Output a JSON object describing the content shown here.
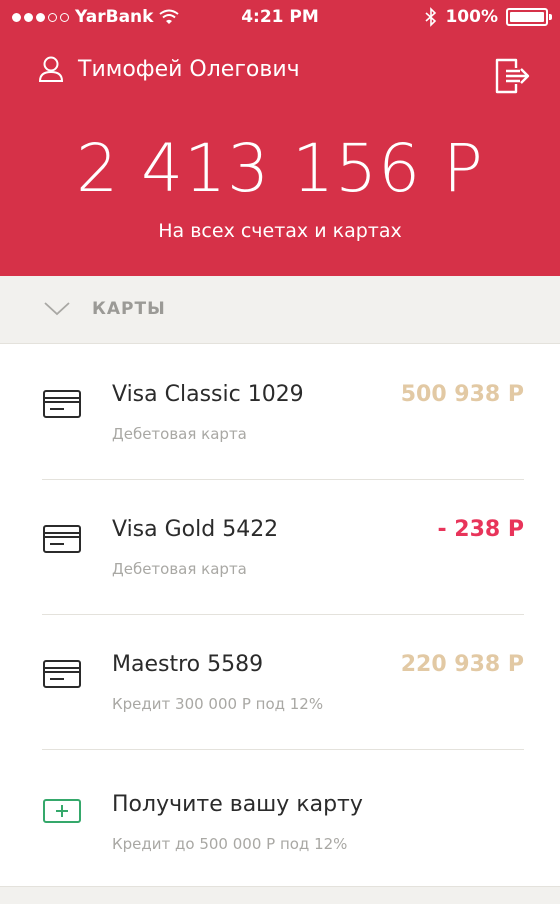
{
  "status_bar": {
    "carrier": "YarBank",
    "time": "4:21 PM",
    "battery": "100%",
    "signal_filled": 3,
    "signal_total": 5
  },
  "header": {
    "user_name": "Тимофей Олегович",
    "balance": "2 413 156 Р",
    "balance_caption": "На всех счетах и картах"
  },
  "section": {
    "title": "КАРТЫ"
  },
  "cards": [
    {
      "name": "Visa Classic 1029",
      "subtitle": "Дебетовая карта",
      "amount": "500 938 Р",
      "amount_color": "#e2c9a4"
    },
    {
      "name": "Visa Gold 5422",
      "subtitle": "Дебетовая карта",
      "amount": "- 238 Р",
      "amount_color": "#e8345a"
    },
    {
      "name": "Maestro 5589",
      "subtitle": "Кредит 300 000 Р под 12%",
      "amount": "220 938 Р",
      "amount_color": "#e2c9a4"
    }
  ],
  "get_card": {
    "title": "Получите вашу карту",
    "subtitle": "Кредит до 500 000 Р под 12%"
  },
  "colors": {
    "brand_red": "#d63148",
    "accent_green": "#35a86b"
  }
}
